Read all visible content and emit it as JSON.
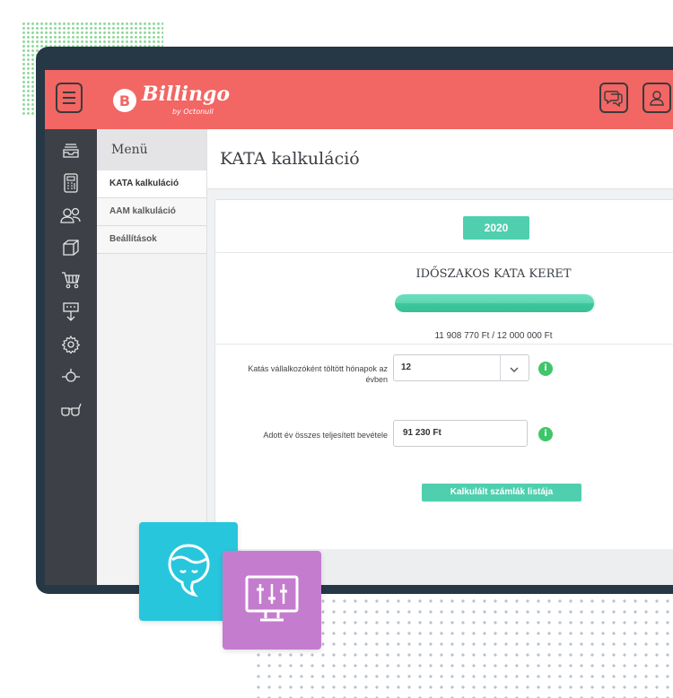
{
  "brand": {
    "logo_letter": "B",
    "name": "Billingo",
    "subtitle": "by Octonull"
  },
  "header": {
    "icons": [
      "hamburger-menu-icon",
      "chat-icon",
      "user-icon"
    ]
  },
  "sidebar": {
    "icons": [
      "inbox-icon",
      "calculator-icon",
      "users-icon",
      "box-icon",
      "cart-icon",
      "download-icon",
      "gear-icon",
      "target-icon",
      "glasses-icon"
    ]
  },
  "menu": {
    "title": "Menü",
    "items": [
      {
        "label": "KATA kalkuláció",
        "active": true
      },
      {
        "label": "AAM kalkuláció",
        "active": false
      },
      {
        "label": "Beállítások",
        "active": false
      }
    ]
  },
  "page": {
    "title": "KATA kalkuláció",
    "year_button": "2020",
    "limit_title": "IDŐSZAKOS KATA KERET",
    "limit_text": "11 908 770 Ft / 12 000 000 Ft",
    "progress_fraction": 0.992,
    "months_label": "Katás vállalkozóként töltött hónapok az évben",
    "months_value": "12",
    "revenue_label": "Adott év összes teljesített bevétele",
    "revenue_value": "91 230 Ft",
    "info_glyph": "i",
    "action_button": "Kalkulált számlák listája"
  },
  "colors": {
    "topbar": "#f26664",
    "accent": "#4fcfae",
    "info": "#3fc66a",
    "sidebar": "#3d4147",
    "tile_teal": "#27c6dd",
    "tile_purple": "#c47cce"
  },
  "decor": {
    "tile_icons": [
      "face-icon",
      "monitor-sliders-icon"
    ]
  }
}
